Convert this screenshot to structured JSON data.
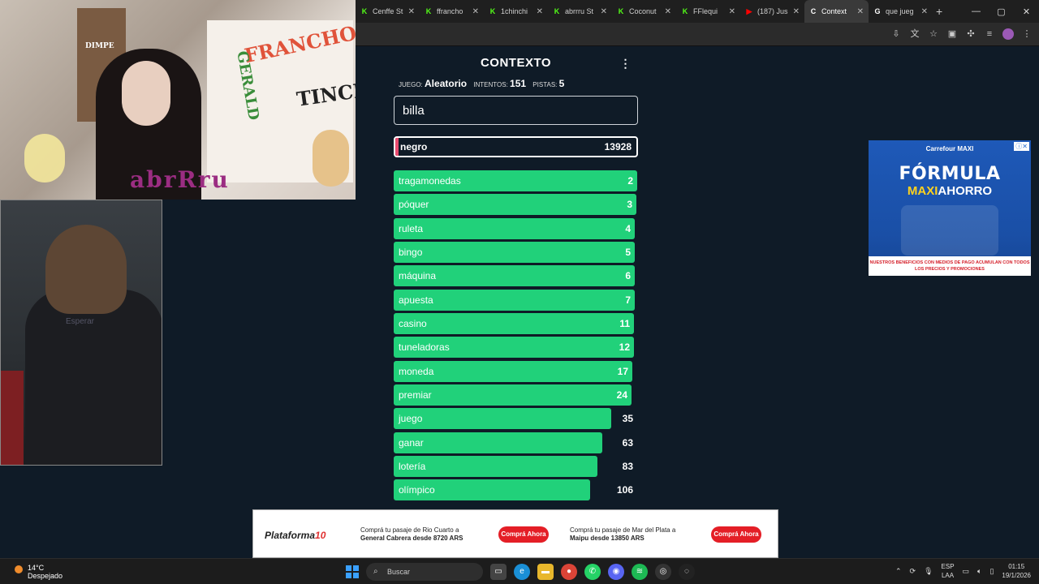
{
  "browser": {
    "tabs": [
      {
        "title": "Cenffe St",
        "favicon": "K-icon"
      },
      {
        "title": "ffrancho",
        "favicon": "K-icon"
      },
      {
        "title": "1chinchi",
        "favicon": "K-icon"
      },
      {
        "title": "abrrru St",
        "favicon": "K-icon"
      },
      {
        "title": "Coconut",
        "favicon": "K-icon"
      },
      {
        "title": "FFlequi",
        "favicon": "K-icon"
      },
      {
        "title": "(187) Jus",
        "favicon": "youtube-icon"
      },
      {
        "title": "Context",
        "favicon": "contexto-icon",
        "active": true
      },
      {
        "title": "que jueg",
        "favicon": "google-icon"
      }
    ],
    "new_tab": "+",
    "window_controls": [
      "—",
      "▢",
      "✕"
    ]
  },
  "webcams": {
    "signs": [
      "FRANCHO",
      "GERALD",
      "TINCHO",
      "DIMPE"
    ],
    "name_letters": "abrRru",
    "hint": "Esperar"
  },
  "game": {
    "title": "CONTEXTO",
    "stats": {
      "juego_label": "JUEGO:",
      "juego_value": "Aleatorio",
      "intentos_label": "INTENTOS:",
      "intentos_value": "151",
      "pistas_label": "PISTAS:",
      "pistas_value": "5"
    },
    "input_value": "billa",
    "last_guess": {
      "word": "negro",
      "rank": "13928"
    },
    "guesses": [
      {
        "word": "tragamonedas",
        "rank": "2",
        "fill": 1.0
      },
      {
        "word": "póquer",
        "rank": "3",
        "fill": 0.995
      },
      {
        "word": "ruleta",
        "rank": "4",
        "fill": 0.99
      },
      {
        "word": "bingo",
        "rank": "5",
        "fill": 0.99
      },
      {
        "word": "máquina",
        "rank": "6",
        "fill": 0.99
      },
      {
        "word": "apuesta",
        "rank": "7",
        "fill": 0.99
      },
      {
        "word": "casino",
        "rank": "11",
        "fill": 0.985
      },
      {
        "word": "tuneladoras",
        "rank": "12",
        "fill": 0.985
      },
      {
        "word": "moneda",
        "rank": "17",
        "fill": 0.98
      },
      {
        "word": "premiar",
        "rank": "24",
        "fill": 0.975
      },
      {
        "word": "juego",
        "rank": "35",
        "fill": 0.965
      },
      {
        "word": "ganar",
        "rank": "63",
        "fill": 0.93
      },
      {
        "word": "lotería",
        "rank": "83",
        "fill": 0.91
      },
      {
        "word": "olímpico",
        "rank": "106",
        "fill": 0.88
      }
    ]
  },
  "ads": {
    "right": {
      "brand": "Carrefour MAXI",
      "headline1": "FÓRMULA",
      "headline2a": "MAXI",
      "headline2b": "AHORRO",
      "strip": "NUESTROS BENEFICIOS CON MEDIOS DE PAGO ACUMULAN CON TODOS LOS PRECIOS Y PROMOCIONES"
    },
    "bottom": {
      "logo_a": "Plataforma",
      "logo_b": "10",
      "text1_line1": "Comprá tu pasaje de Rio Cuarto a",
      "text1_line2": "General Cabrera desde 8720 ARS",
      "text2_line1": "Comprá tu pasaje de Mar del Plata a",
      "text2_line2": "Maipu desde 13850 ARS",
      "button": "Comprá Ahora"
    }
  },
  "taskbar": {
    "temp": "14°C",
    "weather": "Despejado",
    "search_placeholder": "Buscar",
    "lang1": "ESP",
    "lang2": "LAA",
    "time": "01:15",
    "date": "19/1/2026"
  },
  "colors": {
    "bg": "#0f1b27",
    "bar": "#21d17a",
    "last_guess_fill": "#e94b6f"
  }
}
